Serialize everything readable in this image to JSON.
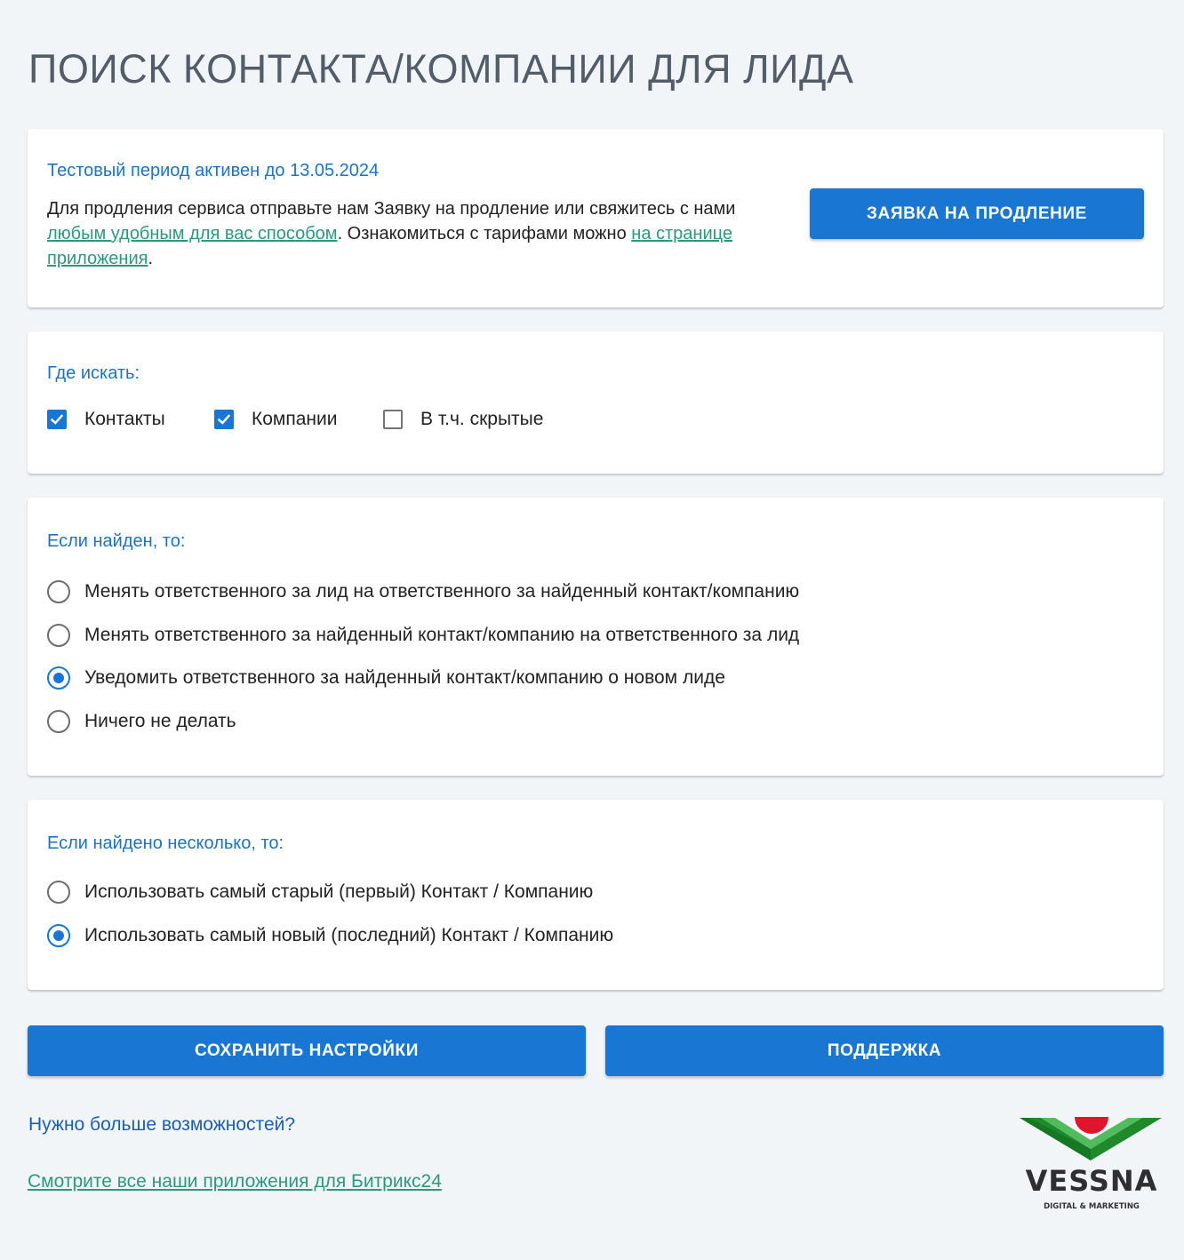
{
  "page_title": "ПОИСК КОНТАКТА/КОМПАНИИ ДЛЯ ЛИДА",
  "trial": {
    "title": "Тестовый период активен до 13.05.2024",
    "text_part1": "Для продления сервиса отправьте нам Заявку на продление или свяжитесь с нами ",
    "link1": "любым удобным для вас способом",
    "text_part2": ". Ознакомиться с тарифами можно ",
    "link2": "на странице приложения",
    "text_part3": ".",
    "button_label": "ЗАЯВКА НА ПРОДЛЕНИЕ"
  },
  "where": {
    "title": "Где искать:",
    "options": [
      {
        "label": "Контакты",
        "checked": true
      },
      {
        "label": "Компании",
        "checked": true
      },
      {
        "label": "В т.ч. скрытые",
        "checked": false
      }
    ]
  },
  "if_found": {
    "title": "Если найден, то:",
    "options": [
      {
        "label": "Менять ответственного за лид на ответственного за найденный контакт/компанию",
        "selected": false
      },
      {
        "label": "Менять ответственного за найденный контакт/компанию на ответственного за лид",
        "selected": false
      },
      {
        "label": "Уведомить ответственного за найденный контакт/компанию о новом лиде",
        "selected": true
      },
      {
        "label": "Ничего не делать",
        "selected": false
      }
    ]
  },
  "if_many": {
    "title": "Если найдено несколько, то:",
    "options": [
      {
        "label": "Использовать самый старый (первый) Контакт / Компанию",
        "selected": false
      },
      {
        "label": "Использовать самый новый (последний) Контакт / Компанию",
        "selected": true
      }
    ]
  },
  "buttons": {
    "save": "СОХРАНИТЬ НАСТРОЙКИ",
    "support": "ПОДДЕРЖКА"
  },
  "footer": {
    "question": "Нужно больше возможностей?",
    "link": "Смотрите все наши приложения для Битрикс24"
  },
  "logo": {
    "name": "VESSNA",
    "tagline": "DIGITAL & MARKETING"
  },
  "colors": {
    "accent": "#1976d2",
    "heading_blue": "#1a73c9",
    "link_green": "#2a9a7b",
    "background": "#f2f5f8",
    "title_gray": "#535c69"
  }
}
